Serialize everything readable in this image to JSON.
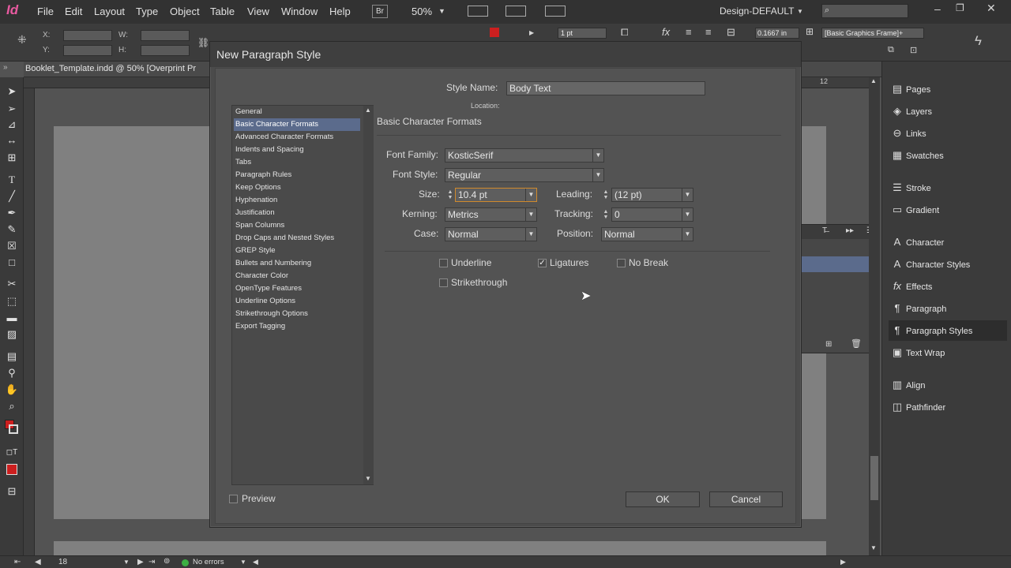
{
  "app": {
    "logo": "Id",
    "menus": [
      "File",
      "Edit",
      "Layout",
      "Type",
      "Object",
      "Table",
      "View",
      "Window",
      "Help"
    ],
    "bridge_label": "Br",
    "zoom": "50%",
    "workspace": "Design-DEFAULT",
    "search_placeholder": ""
  },
  "control": {
    "x_label": "X:",
    "y_label": "Y:",
    "w_label": "W:",
    "h_label": "H:",
    "stroke_weight": "1 pt",
    "offset": "0.1667 in",
    "frame_style": "[Basic Graphics Frame]+"
  },
  "document": {
    "tab_title": "Booklet_Template.indd @ 50% [Overprint Pr",
    "ruler_mark": "12",
    "page_number": "18",
    "status": "No errors"
  },
  "panels": [
    {
      "icon": "pages-icon",
      "glyph": "▤",
      "label": "Pages"
    },
    {
      "icon": "layers-icon",
      "glyph": "◈",
      "label": "Layers"
    },
    {
      "icon": "links-icon",
      "glyph": "⊖",
      "label": "Links"
    },
    {
      "icon": "swatches-icon",
      "glyph": "▦",
      "label": "Swatches"
    },
    {
      "icon": "stroke-icon",
      "glyph": "☰",
      "label": "Stroke"
    },
    {
      "icon": "gradient-icon",
      "glyph": "▭",
      "label": "Gradient"
    },
    {
      "icon": "character-icon",
      "glyph": "A",
      "label": "Character"
    },
    {
      "icon": "character-styles-icon",
      "glyph": "A",
      "label": "Character Styles"
    },
    {
      "icon": "effects-icon",
      "glyph": "fx",
      "label": "Effects"
    },
    {
      "icon": "paragraph-icon",
      "glyph": "¶",
      "label": "Paragraph"
    },
    {
      "icon": "paragraph-styles-icon",
      "glyph": "¶",
      "label": "Paragraph Styles"
    },
    {
      "icon": "text-wrap-icon",
      "glyph": "▣",
      "label": "Text Wrap"
    },
    {
      "icon": "align-icon",
      "glyph": "▥",
      "label": "Align"
    },
    {
      "icon": "pathfinder-icon",
      "glyph": "◫",
      "label": "Pathfinder"
    }
  ],
  "dialog": {
    "title": "New Paragraph Style",
    "style_name_label": "Style Name:",
    "style_name": "Body Text",
    "location_label": "Location:",
    "section_title": "Basic Character Formats",
    "categories": [
      "General",
      "Basic Character Formats",
      "Advanced Character Formats",
      "Indents and Spacing",
      "Tabs",
      "Paragraph Rules",
      "Keep Options",
      "Hyphenation",
      "Justification",
      "Span Columns",
      "Drop Caps and Nested Styles",
      "GREP Style",
      "Bullets and Numbering",
      "Character Color",
      "OpenType Features",
      "Underline Options",
      "Strikethrough Options",
      "Export Tagging"
    ],
    "selected_category": "Basic Character Formats",
    "font_family_label": "Font Family:",
    "font_family": "KosticSerif",
    "font_style_label": "Font Style:",
    "font_style": "Regular",
    "size_label": "Size:",
    "size": "10.4 pt",
    "leading_label": "Leading:",
    "leading": "(12 pt)",
    "kerning_label": "Kerning:",
    "kerning": "Metrics",
    "tracking_label": "Tracking:",
    "tracking": "0",
    "case_label": "Case:",
    "case": "Normal",
    "position_label": "Position:",
    "position": "Normal",
    "underline_label": "Underline",
    "underline_checked": false,
    "ligatures_label": "Ligatures",
    "ligatures_checked": true,
    "nobreak_label": "No Break",
    "nobreak_checked": false,
    "strikethrough_label": "Strikethrough",
    "strikethrough_checked": false,
    "preview_label": "Preview",
    "preview_checked": false,
    "ok_label": "OK",
    "cancel_label": "Cancel"
  },
  "colors": {
    "selection": "#5b6b8c",
    "stroke_swatch": "#cc1f1f",
    "ok_status": "#3cb043"
  }
}
